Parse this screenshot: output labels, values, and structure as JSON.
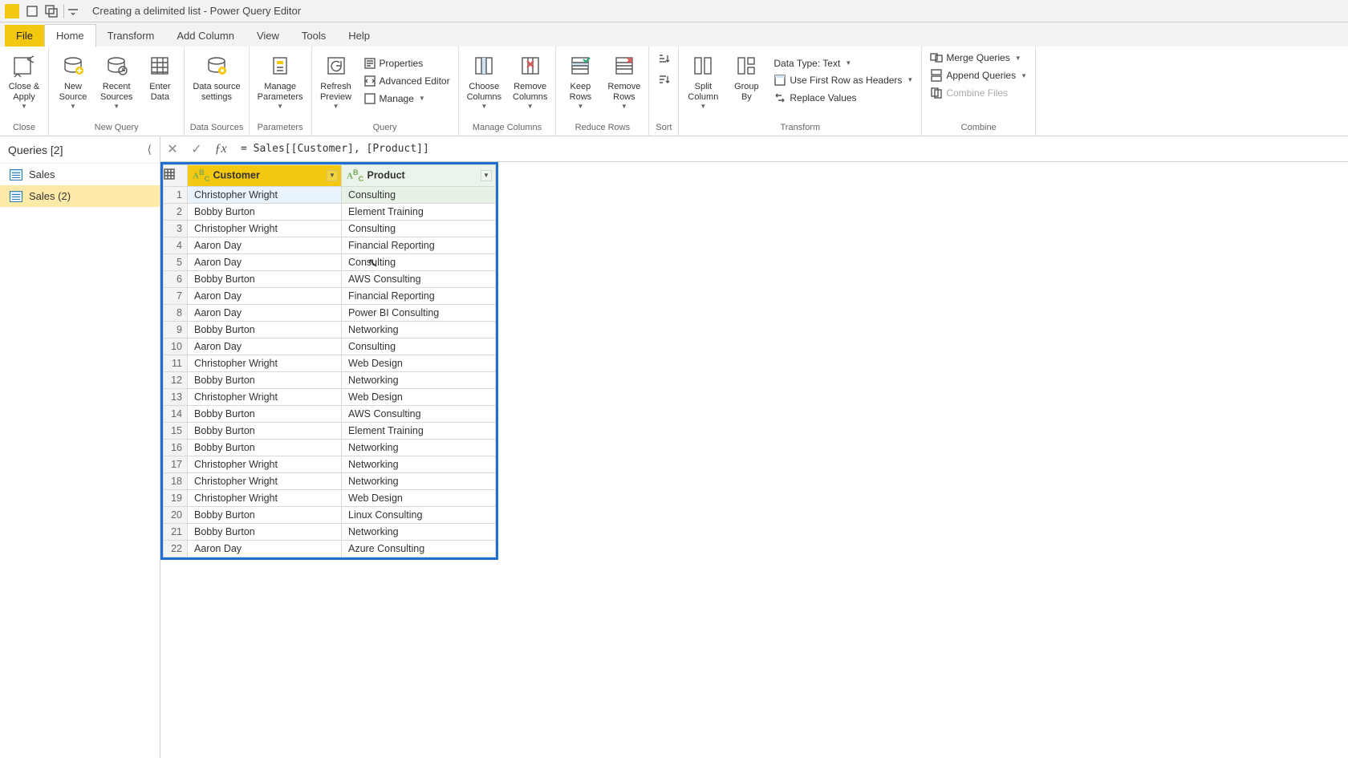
{
  "window": {
    "title": "Creating a delimited list - Power Query Editor"
  },
  "menu": {
    "file": "File",
    "tabs": [
      "Home",
      "Transform",
      "Add Column",
      "View",
      "Tools",
      "Help"
    ],
    "active": "Home"
  },
  "ribbon": {
    "close": {
      "closeApply": "Close &\nApply",
      "group": "Close"
    },
    "newquery": {
      "newSource": "New\nSource",
      "recentSources": "Recent\nSources",
      "enterData": "Enter\nData",
      "group": "New Query"
    },
    "datasources": {
      "settings": "Data source\nsettings",
      "group": "Data Sources"
    },
    "parameters": {
      "manage": "Manage\nParameters",
      "group": "Parameters"
    },
    "query": {
      "refresh": "Refresh\nPreview",
      "properties": "Properties",
      "advanced": "Advanced Editor",
      "manage": "Manage",
      "group": "Query"
    },
    "manageCols": {
      "choose": "Choose\nColumns",
      "remove": "Remove\nColumns",
      "group": "Manage Columns"
    },
    "reduce": {
      "keep": "Keep\nRows",
      "removeRows": "Remove\nRows",
      "group": "Reduce Rows"
    },
    "sort": {
      "group": "Sort"
    },
    "transform": {
      "split": "Split\nColumn",
      "groupBy": "Group\nBy",
      "dataType": "Data Type: Text",
      "firstRow": "Use First Row as Headers",
      "replace": "Replace Values",
      "group": "Transform"
    },
    "combine": {
      "merge": "Merge Queries",
      "append": "Append Queries",
      "combineFiles": "Combine Files",
      "group": "Combine"
    }
  },
  "queries": {
    "title": "Queries [2]",
    "items": [
      {
        "name": "Sales",
        "selected": false
      },
      {
        "name": "Sales (2)",
        "selected": true
      }
    ]
  },
  "formula": "= Sales[[Customer], [Product]]",
  "grid": {
    "columns": [
      {
        "name": "Customer",
        "typeIcon": "ABC",
        "selected": true
      },
      {
        "name": "Product",
        "typeIcon": "ABC",
        "selected": false
      }
    ],
    "rows": [
      {
        "n": 1,
        "c": "Christopher Wright",
        "p": "Consulting"
      },
      {
        "n": 2,
        "c": "Bobby Burton",
        "p": "Element Training"
      },
      {
        "n": 3,
        "c": "Christopher Wright",
        "p": "Consulting"
      },
      {
        "n": 4,
        "c": "Aaron Day",
        "p": "Financial Reporting"
      },
      {
        "n": 5,
        "c": "Aaron Day",
        "p": "Consulting"
      },
      {
        "n": 6,
        "c": "Bobby Burton",
        "p": "AWS Consulting"
      },
      {
        "n": 7,
        "c": "Aaron Day",
        "p": "Financial Reporting"
      },
      {
        "n": 8,
        "c": "Aaron Day",
        "p": "Power BI Consulting"
      },
      {
        "n": 9,
        "c": "Bobby Burton",
        "p": "Networking"
      },
      {
        "n": 10,
        "c": "Aaron Day",
        "p": "Consulting"
      },
      {
        "n": 11,
        "c": "Christopher Wright",
        "p": "Web Design"
      },
      {
        "n": 12,
        "c": "Bobby Burton",
        "p": "Networking"
      },
      {
        "n": 13,
        "c": "Christopher Wright",
        "p": "Web Design"
      },
      {
        "n": 14,
        "c": "Bobby Burton",
        "p": "AWS Consulting"
      },
      {
        "n": 15,
        "c": "Bobby Burton",
        "p": "Element Training"
      },
      {
        "n": 16,
        "c": "Bobby Burton",
        "p": "Networking"
      },
      {
        "n": 17,
        "c": "Christopher Wright",
        "p": "Networking"
      },
      {
        "n": 18,
        "c": "Christopher Wright",
        "p": "Networking"
      },
      {
        "n": 19,
        "c": "Christopher Wright",
        "p": "Web Design"
      },
      {
        "n": 20,
        "c": "Bobby Burton",
        "p": "Linux Consulting"
      },
      {
        "n": 21,
        "c": "Bobby Burton",
        "p": "Networking"
      },
      {
        "n": 22,
        "c": "Aaron Day",
        "p": "Azure Consulting"
      }
    ]
  }
}
